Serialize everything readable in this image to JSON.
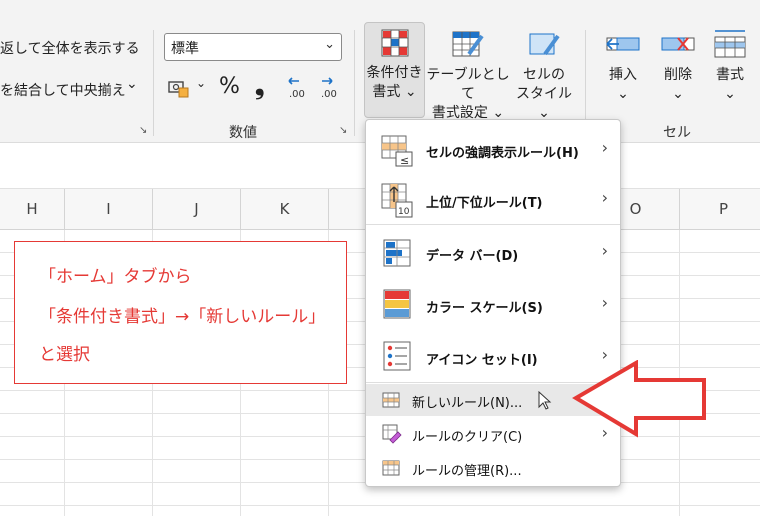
{
  "ribbon": {
    "wrap_text_label": "返して全体を表示する",
    "merge_center_label": "を結合して中央揃え",
    "merge_chevron": "⌄",
    "number_format_value": "標準",
    "select_chevron": "⌄",
    "number_group_label": "数値",
    "percent": "%",
    "comma": "❟",
    "currency_chevron": "⌄",
    "cond_format": {
      "line1": "条件付き",
      "line2": "書式 ⌄"
    },
    "table_format": {
      "line1": "テーブルとして",
      "line2": "書式設定 ⌄"
    },
    "cell_style": {
      "line1": "セルの",
      "line2": "スタイル ⌄"
    },
    "insert": {
      "line1": "挿入",
      "line2": "⌄"
    },
    "delete": {
      "line1": "削除",
      "line2": "⌄"
    },
    "format": {
      "line1": "書式",
      "line2": "⌄"
    },
    "cells_group_label": "セル",
    "launcher": "↘"
  },
  "columns_left": [
    "H",
    "I",
    "J",
    "K"
  ],
  "columns_right": [
    "O",
    "P"
  ],
  "annotation": {
    "line1": "「ホーム」タブから",
    "line2": "「条件付き書式」→「新しいルール」",
    "line3": "と選択"
  },
  "menu": {
    "items": [
      {
        "label": "セルの強調表示ルール(H)",
        "icon": "highlight-rules-icon"
      },
      {
        "label": "上位/下位ルール(T)",
        "icon": "top-bottom-icon"
      },
      {
        "label": "データ バー(D)",
        "icon": "data-bars-icon"
      },
      {
        "label": "カラー スケール(S)",
        "icon": "color-scales-icon"
      },
      {
        "label": "アイコン セット(I)",
        "icon": "icon-sets-icon"
      }
    ],
    "new_rule": "新しいルール(N)...",
    "clear_rules": "ルールのクリア(C)",
    "manage_rules": "ルールの管理(R)...",
    "submenu_arrow": "›"
  },
  "colors": {
    "accent_red": "#e53935",
    "accent_blue": "#1e73c8"
  }
}
